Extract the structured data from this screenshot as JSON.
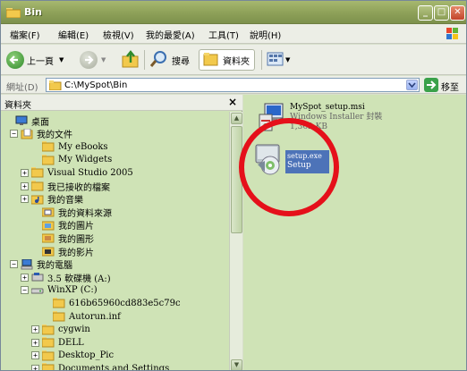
{
  "window": {
    "title": "Bin"
  },
  "menu": [
    "檔案(F)",
    "編輯(E)",
    "檢視(V)",
    "我的最愛(A)",
    "工具(T)",
    "說明(H)"
  ],
  "toolbar": {
    "back": "上一頁",
    "search": "搜尋",
    "folders": "資料夾"
  },
  "address": {
    "label": "網址(D)",
    "value": "C:\\MySpot\\Bin",
    "go": "移至"
  },
  "folder_pane": {
    "title": "資料夾",
    "close": "×",
    "tree": [
      {
        "label": "桌面",
        "icon": "desktop-icon",
        "exp": ""
      },
      {
        "label": "我的文件",
        "icon": "my-documents-icon",
        "exp": "−"
      },
      {
        "label": "My eBooks",
        "icon": "folder-icon",
        "exp": ""
      },
      {
        "label": "My Widgets",
        "icon": "folder-icon",
        "exp": ""
      },
      {
        "label": "Visual Studio 2005",
        "icon": "folder-icon",
        "exp": "+"
      },
      {
        "label": "我已接收的檔案",
        "icon": "folder-icon",
        "exp": "+"
      },
      {
        "label": "我的音樂",
        "icon": "music-folder-icon",
        "exp": "+"
      },
      {
        "label": "我的資料來源",
        "icon": "data-source-icon",
        "exp": ""
      },
      {
        "label": "我的圖片",
        "icon": "pictures-folder-icon",
        "exp": ""
      },
      {
        "label": "我的圖形",
        "icon": "shapes-folder-icon",
        "exp": ""
      },
      {
        "label": "我的影片",
        "icon": "videos-folder-icon",
        "exp": ""
      },
      {
        "label": "我的電腦",
        "icon": "my-computer-icon",
        "exp": "−"
      },
      {
        "label": "3.5 軟碟機 (A:)",
        "icon": "floppy-drive-icon",
        "exp": "+"
      },
      {
        "label": "WinXP (C:)",
        "icon": "hard-drive-icon",
        "exp": "−"
      },
      {
        "label": "616b65960cd883e5c79c",
        "icon": "folder-icon",
        "exp": ""
      },
      {
        "label": "Autorun.inf",
        "icon": "folder-icon",
        "exp": ""
      },
      {
        "label": "cygwin",
        "icon": "folder-icon",
        "exp": "+"
      },
      {
        "label": "DELL",
        "icon": "folder-icon",
        "exp": "+"
      },
      {
        "label": "Desktop_Pic",
        "icon": "folder-icon",
        "exp": "+"
      },
      {
        "label": "Documents and Settings",
        "icon": "folder-icon",
        "exp": "+"
      }
    ]
  },
  "files": [
    {
      "name": "MySpot_setup.msi",
      "line2": "Windows Installer 封裝",
      "line3": "1,362 KB",
      "icon": "msi-installer-icon"
    },
    {
      "name": "setup.exe",
      "line2": "Setup",
      "icon": "setup-exe-icon"
    }
  ]
}
